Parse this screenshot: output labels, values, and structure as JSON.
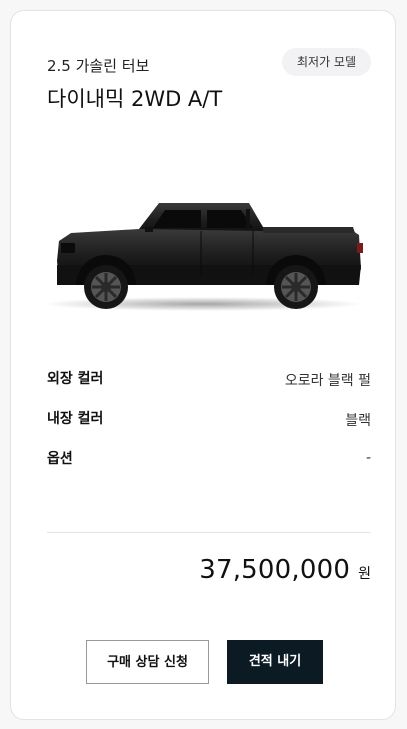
{
  "card": {
    "engine": "2.5 가솔린 터보",
    "badge": "최저가 모델",
    "model": "다이내믹 2WD A/T",
    "image_alt": "pickup-truck-side-view"
  },
  "specs": [
    {
      "label": "외장 컬러",
      "value": "오로라 블랙 펄"
    },
    {
      "label": "내장 컬러",
      "value": "블랙"
    },
    {
      "label": "옵션",
      "value": "-"
    }
  ],
  "price": {
    "amount": "37,500,000",
    "unit": "원"
  },
  "actions": {
    "consult_label": "구매 상담 신청",
    "estimate_label": "견적 내기"
  },
  "colors": {
    "primary_button": "#0c1a24",
    "badge_bg": "#f2f2f4"
  }
}
